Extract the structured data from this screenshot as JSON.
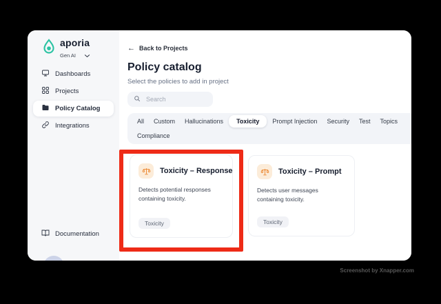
{
  "sidebar": {
    "logo": {
      "brand": "aporia",
      "workspace": "Gen AI"
    },
    "items": [
      {
        "label": "Dashboards",
        "icon": "dashboards-icon",
        "active": false
      },
      {
        "label": "Projects",
        "icon": "projects-icon",
        "active": false
      },
      {
        "label": "Policy Catalog",
        "icon": "folder-icon",
        "active": true
      },
      {
        "label": "Integrations",
        "icon": "link-icon",
        "active": false
      }
    ],
    "footer_item": {
      "label": "Documentation",
      "icon": "book-icon"
    }
  },
  "main": {
    "back_link": "Back to Projects",
    "title": "Policy catalog",
    "subtitle": "Select the policies to add in project",
    "search": {
      "placeholder": "Search"
    },
    "tabs": [
      {
        "label": "All",
        "active": false
      },
      {
        "label": "Custom",
        "active": false
      },
      {
        "label": "Hallucinations",
        "active": false
      },
      {
        "label": "Toxicity",
        "active": true
      },
      {
        "label": "Prompt Injection",
        "active": false
      },
      {
        "label": "Security",
        "active": false
      },
      {
        "label": "Test",
        "active": false
      },
      {
        "label": "Topics",
        "active": false
      },
      {
        "label": "Compliance",
        "active": false
      }
    ],
    "cards": [
      {
        "title": "Toxicity – Response",
        "description": "Detects potential responses containing toxicity.",
        "tag": "Toxicity",
        "icon": "scales-icon",
        "highlighted": true
      },
      {
        "title": "Toxicity – Prompt",
        "description": "Detects user messages containing toxicity.",
        "tag": "Toxicity",
        "icon": "scales-icon",
        "highlighted": false
      }
    ]
  },
  "annotation": {
    "type": "highlight-rectangle",
    "color": "#ee2b17"
  },
  "watermark": "Screenshot by Xnapper.com",
  "colors": {
    "brand_teal": "#2cc3a3",
    "accent_orange": "#ec8a35",
    "icon_bg_orange": "#fcecd9",
    "sidebar_bg": "#f6f7f9",
    "chip_bg": "#f2f4f8",
    "text_dark": "#161d2d",
    "highlight_red": "#ee2b17"
  }
}
